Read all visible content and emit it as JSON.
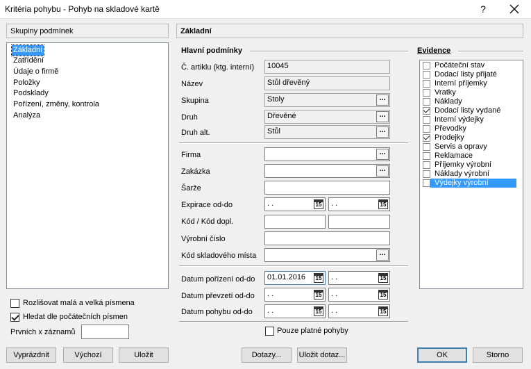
{
  "window": {
    "title": "Kritéria pohybu - Pohyb na skladové kartě",
    "help_label": "?",
    "close_label": "✕"
  },
  "left": {
    "groups_header": "Skupiny podmínek",
    "groups": [
      {
        "label": "Základní",
        "selected": true
      },
      {
        "label": "Zatřídění"
      },
      {
        "label": "Údaje o firmě"
      },
      {
        "label": "Položky"
      },
      {
        "label": "Podsklady"
      },
      {
        "label": "Pořízení, změny, kontrola"
      },
      {
        "label": "Analýza"
      }
    ],
    "case_sensitive_label": "Rozlišovat malá a velká písmena",
    "case_sensitive_checked": false,
    "prefix_search_label": "Hledat dle počátečních písmen",
    "prefix_search_checked": true,
    "first_x_label": "Prvních x záznamů",
    "first_x_value": ""
  },
  "right": {
    "section_title": "Základní",
    "main_conditions_label": "Hlavní podmínky",
    "fields": {
      "article_no": {
        "label": "Č. artiklu (ktg. interní)",
        "value": "10045"
      },
      "name": {
        "label": "Název",
        "value": "Stůl dřevěný"
      },
      "group": {
        "label": "Skupina",
        "value": "Stoly"
      },
      "kind": {
        "label": "Druh",
        "value": "Dřevěné"
      },
      "kind_alt": {
        "label": "Druh alt.",
        "value": "Stůl"
      },
      "company": {
        "label": "Firma",
        "value": ""
      },
      "order": {
        "label": "Zakázka",
        "value": ""
      },
      "batch": {
        "label": "Šarže",
        "value": ""
      },
      "expiry": {
        "label": "Expirace od-do",
        "from": " .  .",
        "to": " .  ."
      },
      "code": {
        "label": "Kód / Kód dopl.",
        "value": "",
        "value2": ""
      },
      "serial": {
        "label": "Výrobní číslo",
        "value": ""
      },
      "location_code": {
        "label": "Kód skladového místa",
        "value": ""
      },
      "acquired": {
        "label": "Datum pořízení od-do",
        "from": "01.01.2016",
        "to": " .  ."
      },
      "transferred": {
        "label": "Datum převzetí od-do",
        "from": " .  .",
        "to": " .  ."
      },
      "movement": {
        "label": "Datum pohybu od-do",
        "from": " .  .",
        "to": " .  ."
      }
    },
    "dots_label": "...",
    "cal_label": "15",
    "valid_only_label": "Pouze platné pohyby",
    "valid_only_checked": false
  },
  "evidence": {
    "header": "Evidence",
    "items": [
      {
        "label": "Počáteční stav",
        "checked": false
      },
      {
        "label": "Dodací listy přijaté",
        "checked": false
      },
      {
        "label": "Interní příjemky",
        "checked": false
      },
      {
        "label": "Vratky",
        "checked": false
      },
      {
        "label": "Náklady",
        "checked": false
      },
      {
        "label": "Dodací listy vydané",
        "checked": true
      },
      {
        "label": "Interní výdejky",
        "checked": false
      },
      {
        "label": "Převodky",
        "checked": false
      },
      {
        "label": "Prodejky",
        "checked": true
      },
      {
        "label": "Servis a opravy",
        "checked": false
      },
      {
        "label": "Reklamace",
        "checked": false
      },
      {
        "label": "Příjemky výrobní",
        "checked": false
      },
      {
        "label": "Náklady výrobní",
        "checked": false
      },
      {
        "label": "Výdejky výrobní",
        "checked": false,
        "selected": true
      }
    ]
  },
  "buttons": {
    "clear": "Vyprázdnit",
    "default": "Výchozí",
    "save": "Uložit",
    "queries": "Dotazy...",
    "save_query": "Uložit dotaz...",
    "ok": "OK",
    "cancel": "Storno"
  }
}
